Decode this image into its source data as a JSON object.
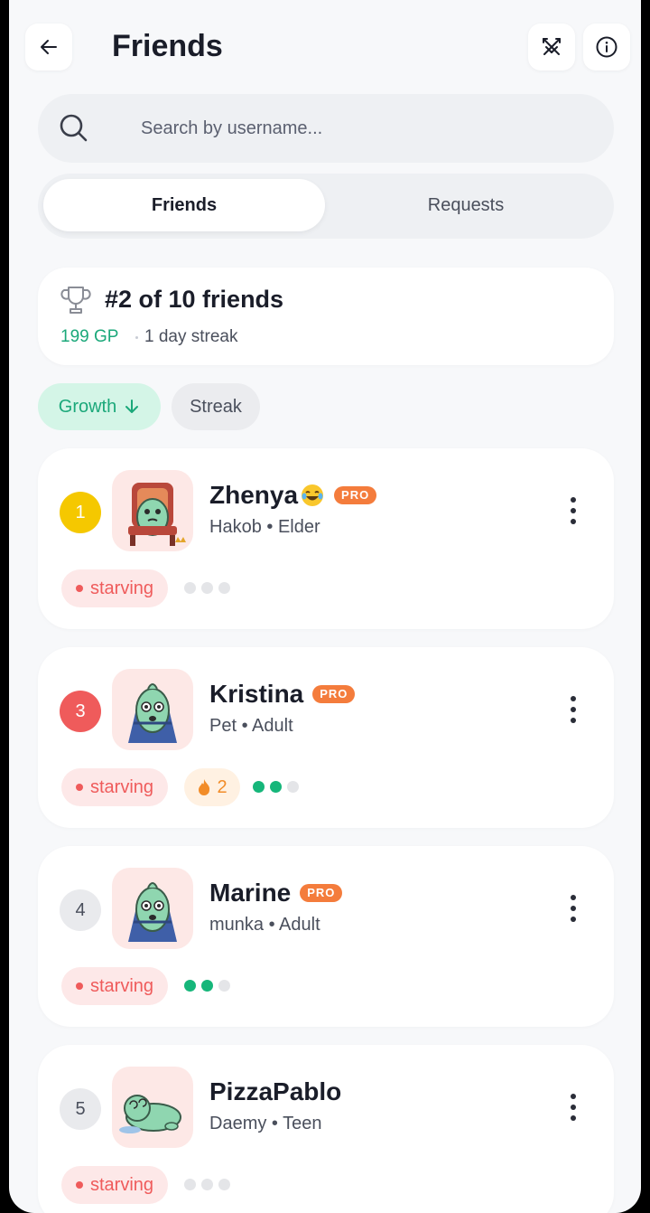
{
  "header": {
    "title": "Friends",
    "back_icon": "arrow-left-icon",
    "battle_icon": "crossed-swords-icon",
    "info_icon": "info-icon"
  },
  "search": {
    "placeholder": "Search by username...",
    "value": ""
  },
  "tabs": [
    {
      "label": "Friends",
      "active": true
    },
    {
      "label": "Requests",
      "active": false
    }
  ],
  "rank": {
    "title": "#2 of 10 friends",
    "gp": "199 GP",
    "streak": "1 day streak"
  },
  "sort": {
    "growth_label": "Growth",
    "streak_label": "Streak"
  },
  "friends": [
    {
      "rank": "1",
      "name": "Zhenya",
      "pro": "PRO",
      "owner": "Hakob",
      "stage": "Elder",
      "status": "starving",
      "fire": null,
      "dots": [
        0,
        0,
        0
      ],
      "rank_color": "#f5c800",
      "rank_text": "#ffffff",
      "pose": "throne",
      "emoji": "joy"
    },
    {
      "rank": "3",
      "name": "Kristina",
      "pro": "PRO",
      "owner": "Pet",
      "stage": "Adult",
      "status": "starving",
      "fire": "2",
      "dots": [
        1,
        1,
        0
      ],
      "rank_color": "#ef5b5b",
      "rank_text": "#ffffff",
      "pose": "cape"
    },
    {
      "rank": "4",
      "name": "Marine",
      "pro": "PRO",
      "owner": "munka",
      "stage": "Adult",
      "status": "starving",
      "fire": null,
      "dots": [
        1,
        1,
        0
      ],
      "rank_color": "#e9eaed",
      "rank_text": "#4a4f5c",
      "pose": "cape"
    },
    {
      "rank": "5",
      "name": "PizzaPablo",
      "pro": null,
      "owner": "Daemy",
      "stage": "Teen",
      "status": "starving",
      "fire": null,
      "dots": [
        0,
        0,
        0
      ],
      "rank_color": "#e9eaed",
      "rank_text": "#4a4f5c",
      "pose": "lying"
    }
  ],
  "colors": {
    "accent_green": "#1ba87a",
    "status_red": "#ef5b5b",
    "pro_orange": "#f47c3c"
  }
}
